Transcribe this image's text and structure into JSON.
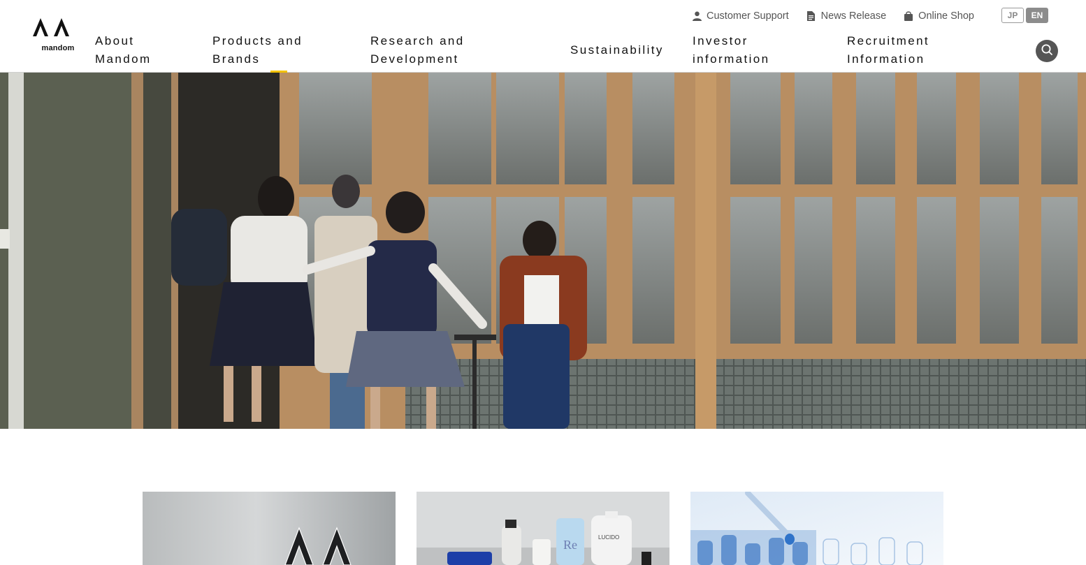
{
  "brand": {
    "logo_text": "mandom"
  },
  "utility_links": [
    {
      "label": "Customer Support",
      "icon": "person-icon"
    },
    {
      "label": "News Release",
      "icon": "document-icon"
    },
    {
      "label": "Online Shop",
      "icon": "shopping-bag-icon"
    }
  ],
  "languages": {
    "jp": "JP",
    "en": "EN",
    "active": "EN"
  },
  "nav": {
    "items": [
      {
        "line1": "About",
        "line2": "Mandom"
      },
      {
        "line1": "Products and",
        "line2": "Brands"
      },
      {
        "line1": "Research and",
        "line2": "Development"
      },
      {
        "line1": "Sustainability",
        "line2": ""
      },
      {
        "line1": "Investor",
        "line2": "information"
      },
      {
        "line1": "Recruitment",
        "line2": "Information"
      }
    ],
    "active_index": 1
  },
  "search": {
    "icon": "search-icon"
  },
  "hero": {
    "description": ""
  },
  "cards": [
    {
      "name": "card-about-mandom"
    },
    {
      "name": "card-products-and-brands"
    },
    {
      "name": "card-research-and-development"
    }
  ],
  "colors": {
    "accent": "#f3c200",
    "nav_text": "#111111",
    "utility_text": "#555555",
    "search_bg": "#555555"
  }
}
